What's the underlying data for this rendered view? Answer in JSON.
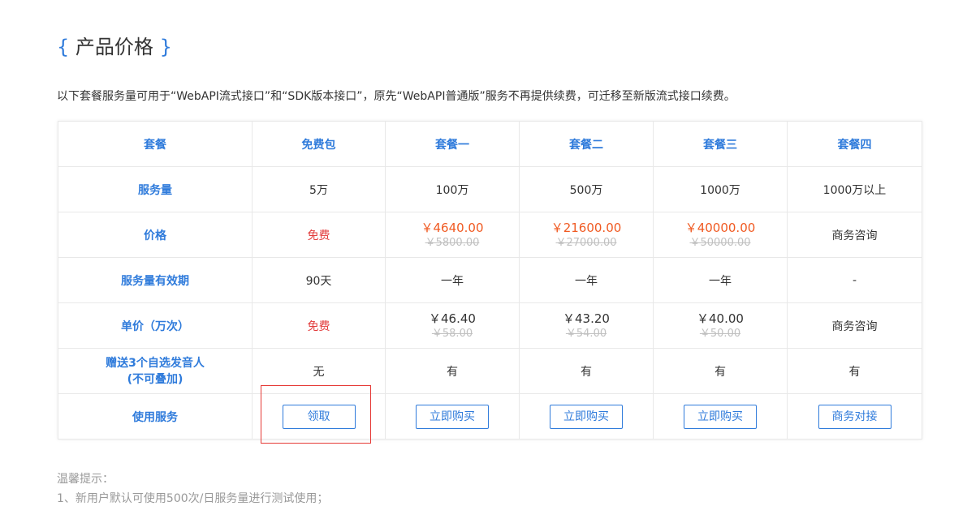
{
  "title": {
    "open": "{",
    "text": "产品价格",
    "close": "}"
  },
  "intro": "以下套餐服务量可用于“WebAPI流式接口”和“SDK版本接口”，原先“WebAPI普通版”服务不再提供续费，可迁移至新版流式接口续费。",
  "table": {
    "header": [
      "套餐",
      "免费包",
      "套餐一",
      "套餐二",
      "套餐三",
      "套餐四"
    ],
    "rows": {
      "volume": {
        "label": "服务量",
        "cells": [
          "5万",
          "100万",
          "500万",
          "1000万",
          "1000万以上"
        ]
      },
      "price": {
        "label": "价格",
        "free": "免费",
        "p1": {
          "now": "￥4640.00",
          "was": "￥5800.00"
        },
        "p2": {
          "now": "￥21600.00",
          "was": "￥27000.00"
        },
        "p3": {
          "now": "￥40000.00",
          "was": "￥50000.00"
        },
        "p4": "商务咨询"
      },
      "validity": {
        "label": "服务量有效期",
        "cells": [
          "90天",
          "一年",
          "一年",
          "一年",
          "-"
        ]
      },
      "unit_price": {
        "label": "单价（万次）",
        "free": "免费",
        "p1": {
          "now": "￥46.40",
          "was": "￥58.00"
        },
        "p2": {
          "now": "￥43.20",
          "was": "￥54.00"
        },
        "p3": {
          "now": "￥40.00",
          "was": "￥50.00"
        },
        "p4": "商务咨询"
      },
      "voices": {
        "label_line1": "赠送3个自选发音人",
        "label_line2": "(不可叠加)",
        "cells": [
          "无",
          "有",
          "有",
          "有",
          "有"
        ]
      },
      "service": {
        "label": "使用服务",
        "buttons": [
          "领取",
          "立即购买",
          "立即购买",
          "立即购买",
          "商务对接"
        ]
      }
    }
  },
  "tips": {
    "title": "温馨提示：",
    "item1": "1、新用户默认可使用500次/日服务量进行测试使用；"
  },
  "colors": {
    "accent": "#2f7bdb",
    "price_orange": "#f05a22",
    "free_red": "#e23c3c",
    "highlight": "#e53935"
  }
}
